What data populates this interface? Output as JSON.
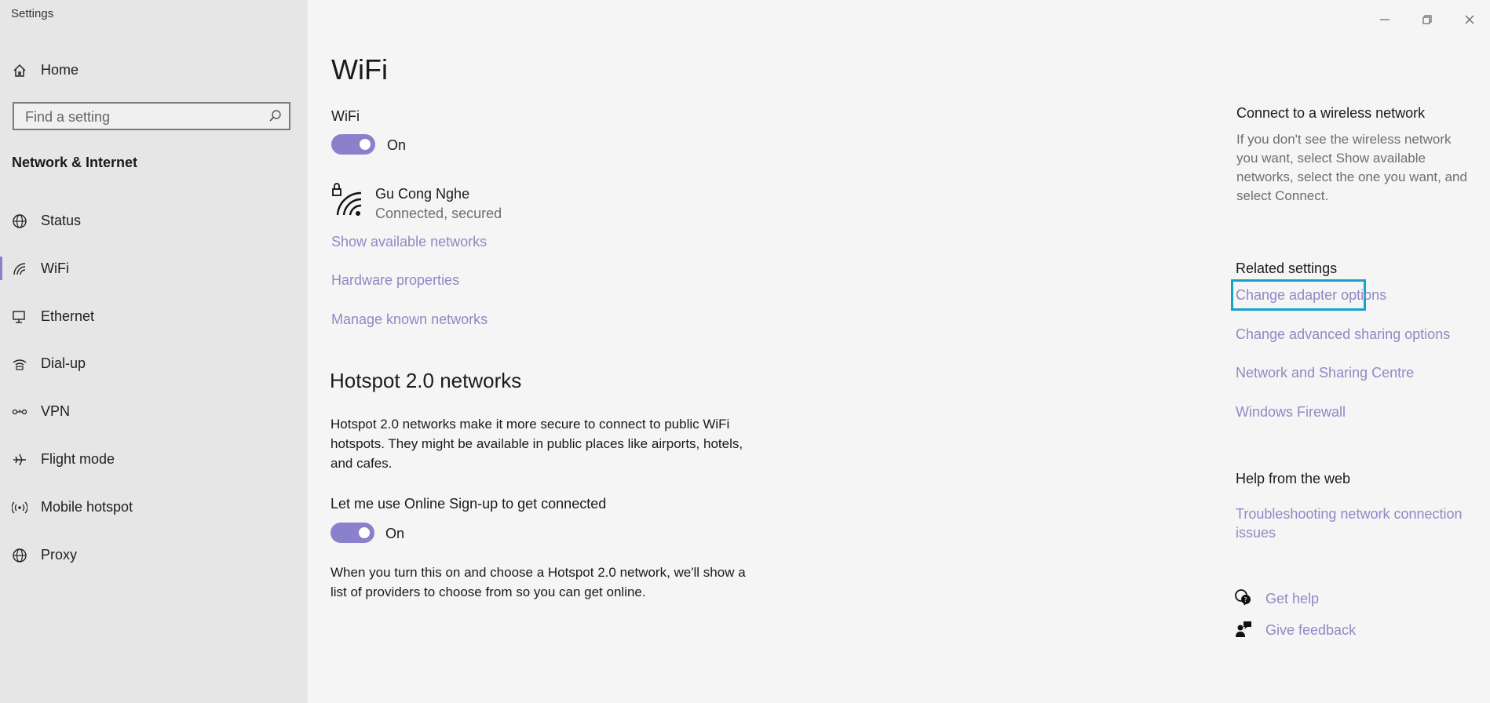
{
  "window": {
    "title": "Settings",
    "controls": [
      "minimize-icon",
      "restore-icon",
      "close-icon"
    ]
  },
  "sidebar": {
    "home_label": "Home",
    "search_placeholder": "Find a setting",
    "section_title": "Network & Internet",
    "items": [
      {
        "label": "Status",
        "icon": "globe-icon",
        "active": false
      },
      {
        "label": "WiFi",
        "icon": "wifi-icon",
        "active": true
      },
      {
        "label": "Ethernet",
        "icon": "ethernet-icon",
        "active": false
      },
      {
        "label": "Dial-up",
        "icon": "dialup-icon",
        "active": false
      },
      {
        "label": "VPN",
        "icon": "vpn-icon",
        "active": false
      },
      {
        "label": "Flight mode",
        "icon": "airplane-icon",
        "active": false
      },
      {
        "label": "Mobile hotspot",
        "icon": "hotspot-icon",
        "active": false
      },
      {
        "label": "Proxy",
        "icon": "globe-icon",
        "active": false
      }
    ]
  },
  "main": {
    "page_title": "WiFi",
    "wifi_label": "WiFi",
    "wifi_toggle_state": "On",
    "network": {
      "name": "Gu Cong Nghe",
      "status": "Connected, secured"
    },
    "links": {
      "show_available": "Show available networks",
      "hardware_properties": "Hardware properties",
      "manage_known": "Manage known networks"
    },
    "hotspot": {
      "heading": "Hotspot 2.0 networks",
      "description_lines": [
        "Hotspot 2.0 networks make it more secure to connect to public WiFi",
        "hotspots. They might be available in public places like airports, hotels,",
        "and cafes."
      ],
      "signup_label": "Let me use Online Sign-up to get connected",
      "signup_toggle_state": "On",
      "signup_note_lines": [
        "When you turn this on and choose a Hotspot 2.0 network, we'll show a",
        "list of providers to choose from so you can get online."
      ]
    }
  },
  "right_panel": {
    "connect": {
      "heading": "Connect to a wireless network",
      "lines": [
        "If you don't see the wireless network",
        "you want, select Show available",
        "networks, select the one you want, and",
        "select Connect."
      ]
    },
    "related": {
      "heading": "Related settings",
      "links": [
        "Change adapter options",
        "Change advanced sharing options",
        "Network and Sharing Centre",
        "Windows Firewall"
      ]
    },
    "help": {
      "heading": "Help from the web",
      "link_lines": [
        "Troubleshooting network connection",
        "issues"
      ]
    },
    "get_help": "Get help",
    "give_feedback": "Give feedback"
  },
  "colors": {
    "accent": "#8b80cc",
    "link": "#8f89c4",
    "highlight_box": "#16a2c9",
    "sidebar_bg": "#e6e6e6",
    "main_bg": "#f5f5f5"
  }
}
